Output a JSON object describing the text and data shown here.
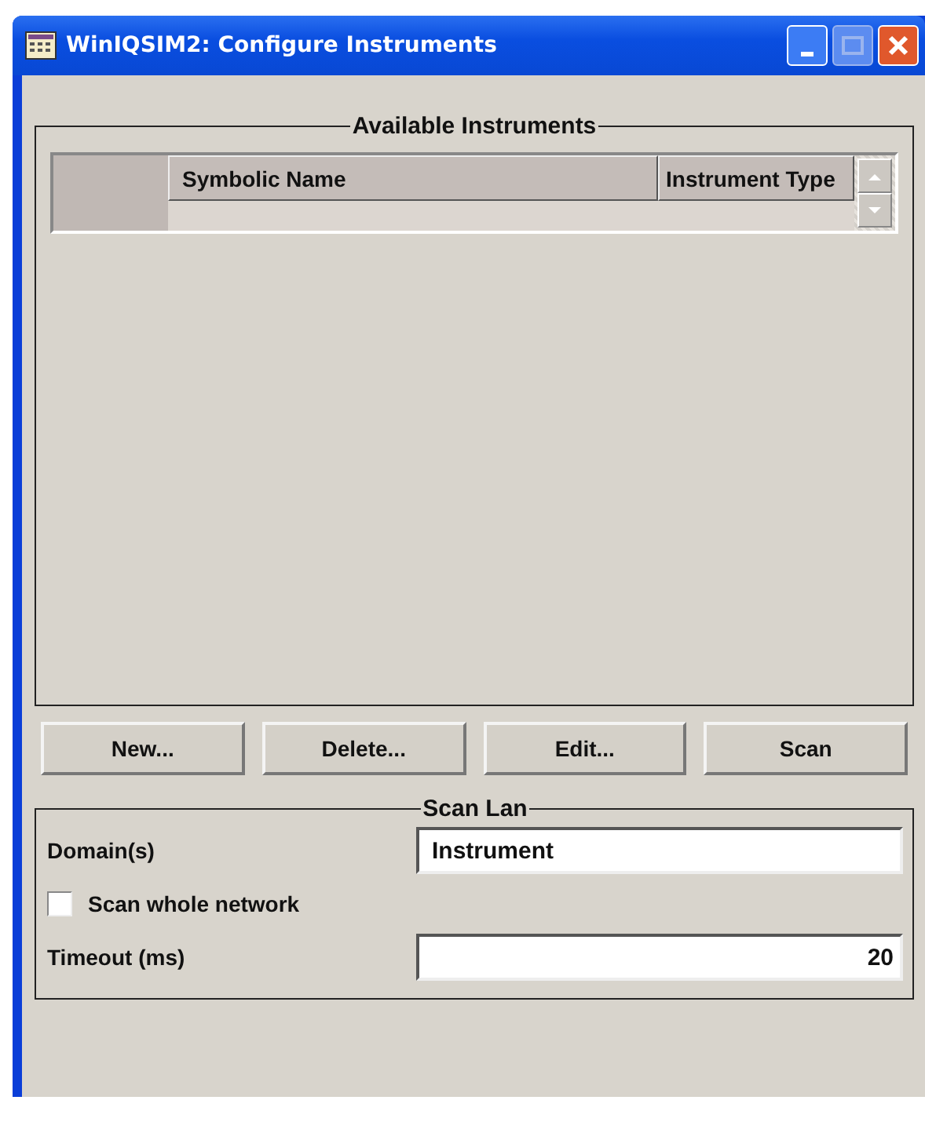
{
  "window": {
    "title": "WinIQSIM2: Configure Instruments"
  },
  "available_instruments": {
    "title": "Available Instruments",
    "columns": [
      "Symbolic Name",
      "Instrument Type"
    ]
  },
  "buttons": [
    "New...",
    "Delete...",
    "Edit...",
    "Scan"
  ],
  "scan_lan": {
    "title": "Scan Lan",
    "domain_label": "Domain(s)",
    "domain_value": "Instrument",
    "scan_whole_network": {
      "label": "Scan whole network",
      "checked": false
    },
    "timeout_label": "Timeout (ms)",
    "timeout_value": "20"
  }
}
